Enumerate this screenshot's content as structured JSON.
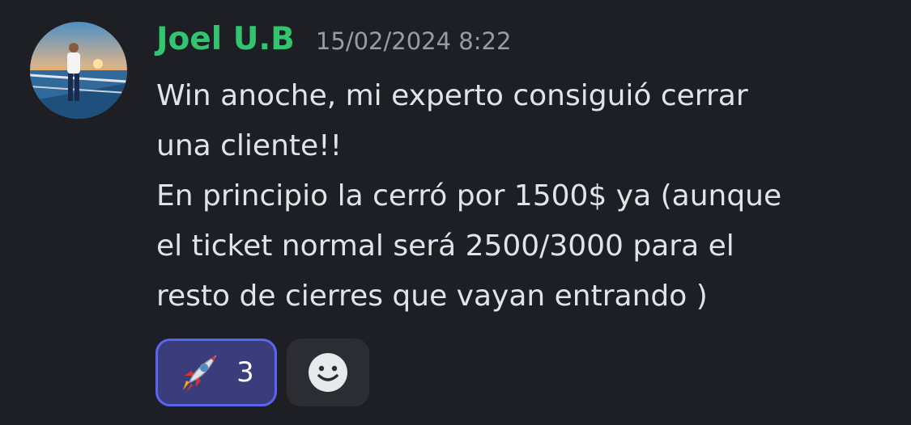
{
  "message": {
    "author": "Joel U.B",
    "timestamp": "15/02/2024 8:22",
    "lines": [
      "Win anoche, mi experto consiguió cerrar",
      "una cliente!!",
      "En principio la cerró por 1500$ ya (aunque",
      "el ticket normal será 2500/3000 para el",
      "resto de cierres que vayan entrando )"
    ],
    "author_color": "#33c46f"
  },
  "reactions": [
    {
      "emoji": "rocket-icon",
      "count": "3",
      "active": true
    }
  ],
  "add_reaction": {
    "icon": "smiley-icon"
  }
}
